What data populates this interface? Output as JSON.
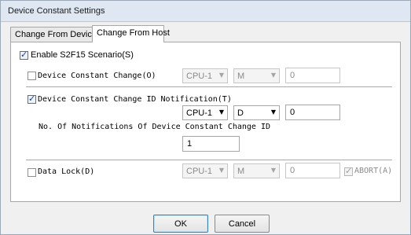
{
  "window": {
    "title": "Device Constant Settings"
  },
  "tabs": [
    {
      "label": "Change From Device",
      "active": false
    },
    {
      "label": "Change From Host",
      "active": true
    }
  ],
  "enable": {
    "label": "Enable S2F15 Scenario(S)",
    "checked": true
  },
  "device_constant_change": {
    "label": "Device Constant Change(O)",
    "checked": false,
    "cpu": "CPU-1",
    "device": "M",
    "value": "0"
  },
  "id_notification": {
    "label": "Device Constant Change ID Notification(T)",
    "checked": true,
    "cpu": "CPU-1",
    "device": "D",
    "value": "0",
    "count_label": "No. Of Notifications Of Device Constant Change ID",
    "count_value": "1"
  },
  "data_lock": {
    "label": "Data Lock(D)",
    "checked": false,
    "cpu": "CPU-1",
    "device": "M",
    "value": "0",
    "abort_label": "ABORT(A)",
    "abort_checked": true
  },
  "buttons": {
    "ok": "OK",
    "cancel": "Cancel"
  },
  "icons": {
    "dropdown": "chevron-down-icon",
    "check": "check-icon"
  }
}
